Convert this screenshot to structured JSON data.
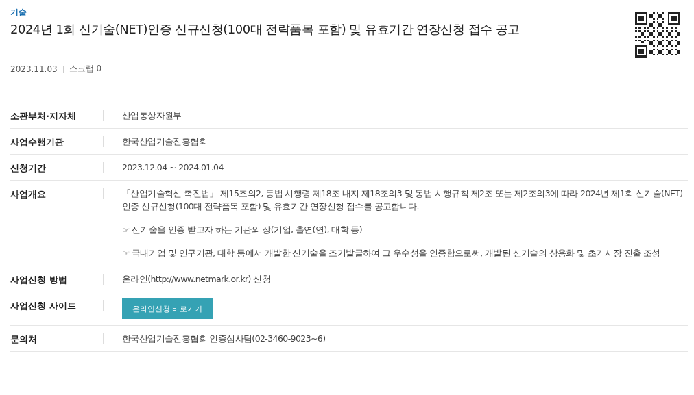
{
  "category": "기술",
  "title": "2024년 1회 신기술(NET)인증 신규신청(100대 전략품목 포함) 및 유효기간 연장신청 접수 공고",
  "meta": {
    "date": "2023.11.03",
    "scrap": "스크랩 0"
  },
  "rows": [
    {
      "label": "소관부처·지자체",
      "kind": "text",
      "value": "산업통상자원부"
    },
    {
      "label": "사업수행기관",
      "kind": "text",
      "value": "한국산업기술진흥협회"
    },
    {
      "label": "신청기간",
      "kind": "text",
      "value": "2023.12.04 ~ 2024.01.04"
    },
    {
      "label": "사업개요",
      "kind": "paragraphs",
      "paragraphs": [
        "「산업기술혁신 촉진법」 제15조의2, 동법 시행령 제18조 내지 제18조의3 및 동법 시행규칙 제2조 또는 제2조의3에 따라 2024년 제1회 신기술(NET)인증 신규신청(100대 전략품목 포함) 및 유효기간 연장신청 접수를 공고합니다.",
        "☞ 신기술을 인증 받고자 하는 기관의 장(기업, 출연(연), 대학 등)",
        "☞ 국내기업 및 연구기관, 대학 등에서 개발한 신기술을 조기발굴하여 그 우수성을 인증함으로써, 개발된 신기술의 상용화 및 초기시장 진출 조성"
      ]
    },
    {
      "label": "사업신청 방법",
      "kind": "text",
      "value": "온라인(http://www.netmark.or.kr) 신청"
    },
    {
      "label": "사업신청 사이트",
      "kind": "button",
      "value": "온라인신청 바로가기"
    },
    {
      "label": "문의처",
      "kind": "text",
      "value": "한국산업기술진흥협회 인증심사팀(02-3460-9023~6)"
    }
  ]
}
